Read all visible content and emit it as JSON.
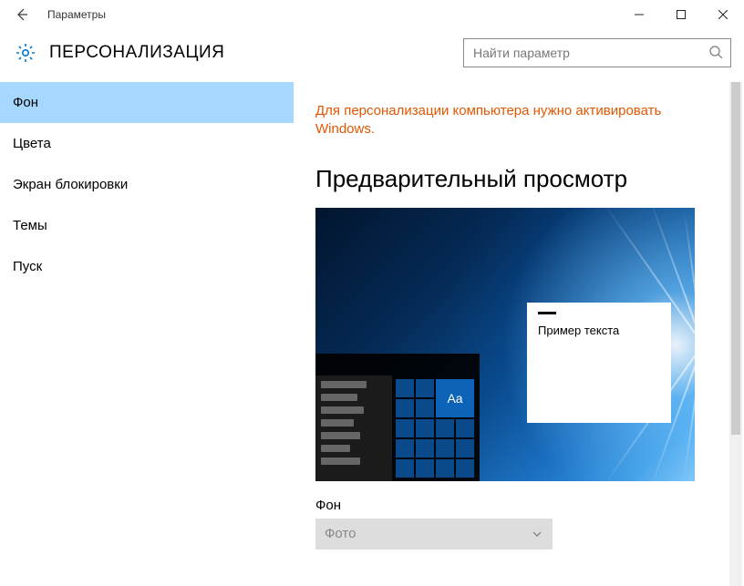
{
  "window": {
    "title": "Параметры"
  },
  "header": {
    "section": "ПЕРСОНАЛИЗАЦИЯ",
    "search_placeholder": "Найти параметр"
  },
  "sidebar": {
    "items": [
      {
        "label": "Фон",
        "selected": true
      },
      {
        "label": "Цвета"
      },
      {
        "label": "Экран блокировки"
      },
      {
        "label": "Темы"
      },
      {
        "label": "Пуск"
      }
    ]
  },
  "main": {
    "activation_warning": "Для персонализации компьютера нужно активировать Windows.",
    "preview_heading": "Предварительный просмотр",
    "sample_text": "Пример текста",
    "tile_label": "Aa",
    "background_label": "Фон",
    "background_value": "Фото"
  }
}
